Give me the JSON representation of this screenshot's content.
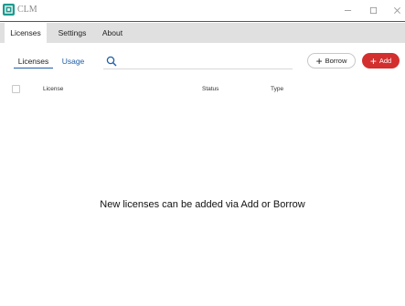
{
  "window": {
    "title": "CLM",
    "logo_icon": "app-logo-icon",
    "controls": [
      "minimize-icon",
      "maximize-icon",
      "close-icon"
    ]
  },
  "main_tabs": [
    {
      "label": "Licenses",
      "active": true
    },
    {
      "label": "Settings",
      "active": false
    },
    {
      "label": "About",
      "active": false
    }
  ],
  "sub_tabs": [
    {
      "label": "Licenses",
      "active": true
    },
    {
      "label": "Usage",
      "active": false
    }
  ],
  "search": {
    "placeholder": "",
    "value": "",
    "icon": "search-icon"
  },
  "actions": {
    "borrow_label": "Borrow",
    "add_label": "Add",
    "plus_glyph": "+"
  },
  "table": {
    "columns": [
      "License",
      "Status",
      "Type"
    ]
  },
  "empty_message": "New licenses can be added via Add or Borrow",
  "colors": {
    "accent_red": "#d32f2f",
    "accent_blue": "#1f5fa8",
    "logo_teal": "#1d9a8e"
  }
}
